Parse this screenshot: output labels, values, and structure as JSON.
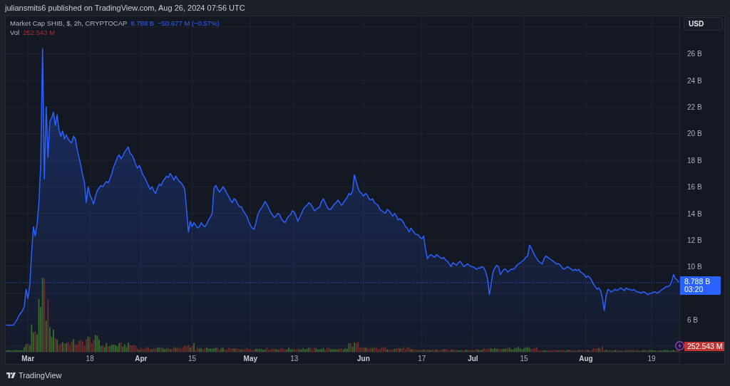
{
  "header": {
    "byline": "juliansmits6 published on TradingView.com, Aug 26, 2024 07:56 UTC"
  },
  "chart": {
    "legend": {
      "value": "8.788 B",
      "change": "−50.677 M (−0.57%)",
      "volume_label": "Vol",
      "volume_value": "252.543 M"
    },
    "currency_button": "USD",
    "last_price_label": {
      "value": "8.788 B",
      "countdown": "03:20"
    },
    "volume_axis_label": "252.543 M",
    "time_label_bold": [
      true,
      false,
      true,
      false,
      true,
      false,
      true,
      false,
      true,
      false,
      true,
      false
    ],
    "chart_data": {
      "type": "area",
      "grid": true,
      "ylim": [
        3.6,
        28.8
      ],
      "yticks": [
        {
          "value": 6,
          "label": "6 B"
        },
        {
          "value": 10,
          "label": "10 B"
        },
        {
          "value": 12,
          "label": "12 B"
        },
        {
          "value": 14,
          "label": "14 B"
        },
        {
          "value": 16,
          "label": "16 B"
        },
        {
          "value": 18,
          "label": "18 B"
        },
        {
          "value": 20,
          "label": "20 B"
        },
        {
          "value": 22,
          "label": "22 B"
        },
        {
          "value": 24,
          "label": "24 B"
        },
        {
          "value": 26,
          "label": "26 B"
        }
      ],
      "categories": [
        null,
        null,
        null,
        null,
        null,
        null,
        null,
        null,
        null,
        null,
        null,
        null,
        "Mar",
        null,
        null,
        null,
        null,
        null,
        null,
        null,
        null,
        null,
        null,
        null,
        null,
        null,
        null,
        null,
        null,
        null,
        null,
        null,
        null,
        null,
        null,
        null,
        null,
        null,
        null,
        null,
        null,
        null,
        null,
        null,
        null,
        null,
        "18",
        null,
        null,
        null,
        null,
        null,
        null,
        null,
        null,
        null,
        null,
        null,
        null,
        null,
        null,
        null,
        null,
        null,
        null,
        null,
        null,
        null,
        null,
        null,
        null,
        null,
        null,
        null,
        "Apr",
        null,
        null,
        null,
        null,
        null,
        null,
        null,
        null,
        null,
        null,
        null,
        null,
        null,
        null,
        null,
        null,
        null,
        null,
        null,
        null,
        null,
        null,
        null,
        null,
        null,
        null,
        null,
        "15",
        null,
        null,
        null,
        null,
        null,
        null,
        null,
        null,
        null,
        null,
        null,
        null,
        null,
        null,
        null,
        null,
        null,
        null,
        null,
        null,
        null,
        null,
        null,
        null,
        null,
        null,
        null,
        null,
        null,
        null,
        null,
        "May",
        null,
        null,
        null,
        null,
        null,
        null,
        null,
        null,
        null,
        null,
        null,
        null,
        null,
        null,
        null,
        null,
        null,
        null,
        null,
        null,
        null,
        null,
        null,
        "13",
        null,
        null,
        null,
        null,
        null,
        null,
        null,
        null,
        null,
        null,
        null,
        null,
        null,
        null,
        null,
        null,
        null,
        null,
        null,
        null,
        null,
        null,
        null,
        null,
        null,
        null,
        null,
        null,
        null,
        null,
        null,
        null,
        null,
        null,
        null,
        null,
        null,
        "Jun",
        null,
        null,
        null,
        null,
        null,
        null,
        null,
        null,
        null,
        null,
        null,
        null,
        null,
        null,
        null,
        null,
        null,
        null,
        null,
        null,
        null,
        null,
        null,
        null,
        null,
        null,
        null,
        null,
        null,
        null,
        null,
        "17",
        null,
        null,
        null,
        null,
        null,
        null,
        null,
        null,
        null,
        null,
        null,
        null,
        null,
        null,
        null,
        null,
        null,
        null,
        null,
        null,
        null,
        null,
        null,
        null,
        null,
        null,
        null,
        "Jul",
        null,
        null,
        null,
        null,
        null,
        null,
        null,
        null,
        null,
        null,
        null,
        null,
        null,
        null,
        null,
        null,
        null,
        null,
        null,
        null,
        null,
        null,
        null,
        null,
        null,
        null,
        null,
        "15",
        null,
        null,
        null,
        null,
        null,
        null,
        null,
        null,
        null,
        null,
        null,
        null,
        null,
        null,
        null,
        null,
        null,
        null,
        null,
        null,
        null,
        null,
        null,
        null,
        null,
        null,
        null,
        null,
        null,
        null,
        null,
        null,
        null,
        "Aug",
        null,
        null,
        null,
        null,
        null,
        null,
        null,
        null,
        null,
        null,
        null,
        null,
        null,
        null,
        null,
        null,
        null,
        null,
        null,
        null,
        null,
        null,
        null,
        null,
        null,
        null,
        null,
        null,
        null,
        null,
        null,
        null,
        null,
        null,
        null,
        "19",
        null,
        null,
        null,
        null,
        null,
        null,
        null,
        null,
        null,
        null,
        null,
        null,
        null,
        null,
        null
      ],
      "series": [
        {
          "name": "Market Cap SHIB, $, 2h, CRYPTOCAP",
          "color": "#2962ff",
          "values": [
            5.6,
            5.6,
            5.6,
            5.6,
            5.6,
            5.8,
            6.0,
            6.3,
            6.5,
            6.7,
            7.0,
            8.3,
            7.6,
            8.6,
            11.0,
            13.0,
            12.3,
            13.2,
            14.7,
            17.7,
            26.4,
            16.6,
            22.0,
            18.2,
            20.9,
            21.2,
            21.6,
            20.6,
            21.4,
            20.3,
            19.8,
            20.2,
            19.6,
            19.9,
            19.6,
            19.4,
            19.3,
            19.8,
            19.6,
            18.8,
            18.2,
            17.6,
            16.9,
            16.3,
            14.8,
            16.0,
            15.4,
            15.1,
            14.7,
            15.3,
            15.7,
            15.9,
            16.1,
            16.0,
            16.2,
            16.4,
            16.3,
            16.6,
            17.0,
            17.5,
            17.8,
            18.2,
            18.4,
            18.1,
            18.3,
            18.6,
            18.8,
            19.0,
            18.5,
            18.4,
            18.1,
            17.7,
            17.4,
            17.6,
            17.3,
            16.9,
            16.7,
            16.4,
            16.1,
            15.8,
            16.0,
            15.7,
            15.5,
            15.9,
            16.2,
            16.1,
            16.4,
            16.6,
            16.8,
            16.7,
            17.0,
            16.8,
            16.5,
            16.8,
            16.6,
            16.4,
            16.3,
            16.1,
            15.8,
            14.2,
            12.6,
            13.4,
            13.0,
            13.3,
            13.1,
            12.9,
            13.0,
            13.3,
            13.1,
            13.0,
            13.2,
            13.5,
            13.7,
            14.0,
            15.9,
            16.1,
            15.8,
            15.6,
            15.8,
            16.0,
            15.8,
            15.5,
            15.3,
            15.0,
            14.8,
            15.1,
            15.0,
            14.7,
            14.5,
            14.5,
            14.2,
            14.0,
            13.8,
            13.4,
            13.1,
            12.9,
            12.8,
            13.3,
            13.9,
            14.2,
            14.4,
            14.6,
            14.9,
            14.7,
            14.4,
            14.1,
            13.9,
            13.7,
            13.8,
            14.0,
            13.9,
            13.6,
            13.4,
            13.3,
            13.6,
            13.8,
            13.9,
            14.2,
            14.1,
            13.8,
            13.4,
            13.7,
            14.0,
            14.3,
            14.5,
            14.6,
            14.8,
            14.7,
            14.5,
            14.2,
            14.3,
            14.4,
            14.5,
            14.9,
            15.1,
            14.8,
            14.5,
            14.3,
            14.3,
            14.5,
            14.7,
            14.8,
            15.0,
            14.8,
            14.6,
            14.8,
            15.0,
            15.2,
            15.5,
            15.4,
            15.7,
            16.9,
            16.4,
            15.9,
            15.6,
            15.5,
            15.3,
            15.5,
            15.4,
            15.1,
            15.0,
            15.1,
            14.8,
            14.7,
            14.6,
            14.3,
            14.2,
            14.1,
            14.0,
            14.3,
            14.2,
            14.0,
            13.8,
            14.0,
            13.8,
            13.5,
            13.6,
            13.5,
            13.3,
            13.0,
            12.9,
            12.6,
            12.9,
            12.7,
            12.5,
            12.4,
            12.4,
            12.2,
            12.1,
            12.3,
            11.3,
            10.6,
            10.8,
            10.9,
            10.8,
            10.7,
            10.9,
            10.8,
            10.7,
            10.6,
            10.7,
            10.5,
            10.4,
            10.2,
            10.0,
            10.3,
            10.2,
            10.1,
            10.3,
            10.4,
            10.2,
            10.0,
            10.1,
            10.2,
            10.1,
            10.0,
            10.0,
            9.9,
            9.8,
            9.9,
            9.9,
            10.0,
            9.9,
            9.6,
            9.1,
            7.9,
            8.7,
            9.6,
            9.9,
            10.1,
            10.0,
            9.4,
            9.6,
            9.8,
            9.8,
            9.6,
            9.7,
            9.8,
            9.8,
            9.9,
            10.1,
            10.2,
            10.3,
            10.4,
            10.5,
            10.7,
            10.8,
            11.6,
            11.4,
            11.1,
            10.8,
            10.6,
            10.4,
            10.3,
            10.2,
            10.6,
            10.8,
            10.7,
            10.6,
            10.5,
            10.4,
            10.3,
            10.2,
            10.2,
            10.1,
            9.9,
            9.8,
            9.9,
            10.0,
            9.9,
            9.8,
            9.7,
            9.8,
            9.7,
            9.8,
            9.6,
            9.5,
            9.4,
            9.2,
            9.3,
            9.2,
            9.0,
            8.7,
            8.5,
            8.3,
            8.4,
            8.2,
            7.6,
            6.7,
            7.8,
            8.3,
            8.2,
            8.1,
            8.2,
            8.3,
            8.2,
            8.3,
            8.4,
            8.3,
            8.2,
            8.4,
            8.3,
            8.3,
            8.2,
            8.3,
            8.2,
            8.1,
            8.1,
            8.0,
            8.1,
            8.1,
            8.0,
            7.9,
            8.0,
            8.0,
            8.1,
            8.1,
            8.0,
            8.1,
            8.2,
            8.3,
            8.4,
            8.5,
            8.5,
            8.6,
            8.9,
            9.4,
            9.1,
            9.0,
            8.8
          ]
        }
      ]
    }
  },
  "footer": {
    "brand": "TradingView"
  }
}
